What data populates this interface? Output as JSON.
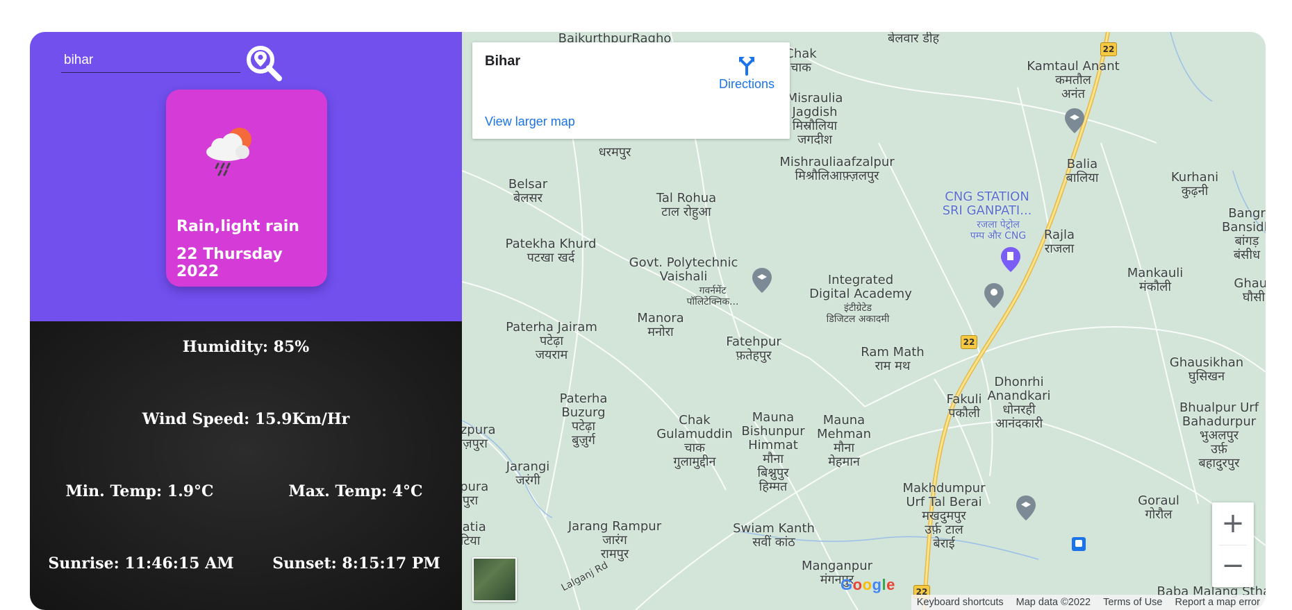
{
  "search": {
    "value": "bihar",
    "button_icon": "location-search-icon"
  },
  "weather_card": {
    "icon": "rain-cloud-sun-icon",
    "description": "Rain,light rain",
    "date": "22 Thursday 2022"
  },
  "stats": {
    "humidity": "Humidity: 85%",
    "wind_speed": "Wind Speed: 15.9Km/Hr",
    "min_temp": "Min. Temp: 1.9°C",
    "max_temp": "Max. Temp: 4°C",
    "sunrise": "Sunrise: 11:46:15 AM",
    "sunset": "Sunset: 8:15:17 PM"
  },
  "map": {
    "info_card": {
      "place": "Bihar",
      "directions": "Directions",
      "larger_map": "View larger map"
    },
    "places": [
      "BaikurthpurRagho",
      "बेलवार डीह",
      "Chak\nचाक",
      "Kamtaul Anant\nकमतौल\nअनंत",
      "Misraulia\nJagdish\nमिस्रौलिया\nजगदीश",
      "धरमपुर",
      "Belsar\nबेलसर",
      "Tal Rohua\nटाल रोहुआ",
      "Mishrauliaafzalpur\nमिश्रौलिआफ़्ज़लपुर",
      "Balia\nबालिया",
      "Kurhani\nकुढ़नी",
      "Patekha Khurd\nपटखा खर्द",
      "Rajla\nराजला",
      "Mankauli\nमंकौली",
      "Paterha Jairam\nपटेढ़ा\nजयराम",
      "Manora\nमनोरा",
      "Fatehpur\nफ़तेहपुर",
      "Ram Math\nराम मथ",
      "Ghausikhan\nघुसिखन",
      "Dhonrhi\nAnandkari\nधोनरही\nआनंदकारी",
      "Fakuli\nपकौली",
      "Paterha\nBuzurg\nपटेढ़ा\nबुज़ुर्ग",
      "Chak\nGulamuddin\nचाक\nगुलामुद्दीन",
      "Mauna\nBishunpur\nHimmat\nमौना\nबिश्नुपुर\nहिम्मत",
      "Mauna\nMehman\nमौना\nमेहमान",
      "Bhualpur Urf\nBahadurpur\nभुअलपुर\nउर्फ़\nबहादुरपुर",
      "Jarangi\nजरंगी",
      "Makhdumpur\nUrf Tal Berai\nमखदुमपुर\nउर्फ़ टाल\nबेराई",
      "Goraul\nगोरौल",
      "Jarang Rampur\nजारंग\nरामपुर",
      "Swiam Kanth\nसवीं कांठ",
      "Manganpur\nमंगनपुर",
      "Baba Malang Sthan",
      "auzpura\nहौज़पुरा",
      "npura\nपुरा",
      "natia\nटिया",
      "Bangr\nBansidh\nबांगड़\nबंसीध",
      "Ghaus\nघौसी"
    ],
    "pois": [
      "Govt. Polytechnic\nVaishali",
      "गवर्नमेंट\nपॉलिटेक्निक...",
      "CNG STATION\nSRI GANPATI...",
      "रजला पेट्रोल\nपम्प और CNG",
      "Integrated\nDigital Academy",
      "इंटीग्रेटेड\nडिजिटल अकादमी"
    ],
    "road_number": "22",
    "road_label": "Lalganj Rd",
    "zoom_in": "+",
    "zoom_out": "−",
    "logo": "Google",
    "attribution": [
      "Keyboard shortcuts",
      "Map data ©2022",
      "Terms of Use",
      "Report a map error"
    ]
  }
}
